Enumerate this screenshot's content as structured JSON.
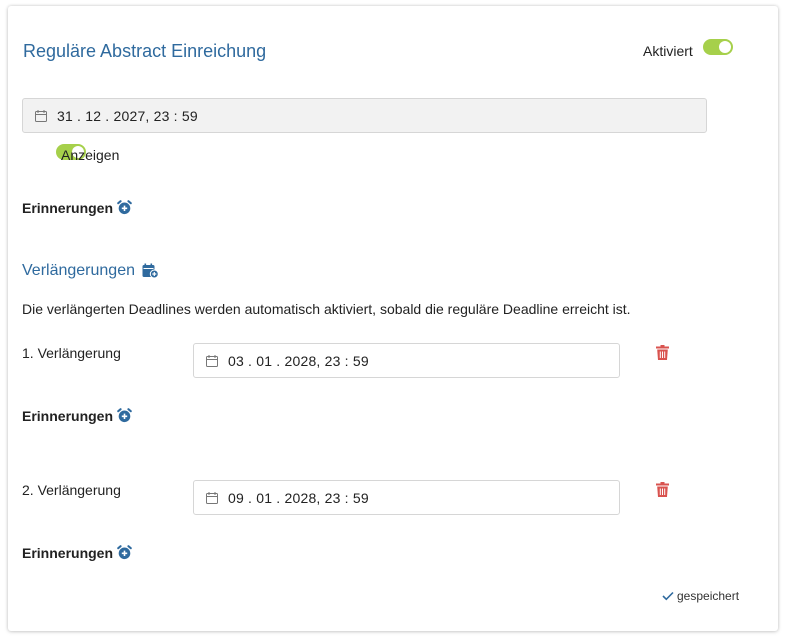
{
  "header": {
    "title": "Reguläre Abstract Einreichung",
    "activated_label": "Aktiviert"
  },
  "main_deadline": {
    "value": "31 . 12 . 2027, 23 : 59",
    "show_label": "Anzeigen"
  },
  "reminders_label": "Erinnerungen",
  "extensions": {
    "title": "Verlängerungen",
    "info": "Die verlängerten Deadlines werden automatisch aktiviert, sobald die reguläre Deadline erreicht ist.",
    "items": [
      {
        "label": "1. Verlängerung",
        "value": "03 . 01 . 2028, 23 : 59",
        "reminders_label": "Erinnerungen"
      },
      {
        "label": "2. Verlängerung",
        "value": "09 . 01 . 2028, 23 : 59",
        "reminders_label": "Erinnerungen"
      }
    ]
  },
  "status": {
    "saved_label": "gespeichert"
  },
  "colors": {
    "accent": "#2f6a9e",
    "toggle_on": "#a6d04b",
    "danger": "#d9534f"
  },
  "icons": [
    "calendar-icon",
    "alarm-plus-icon",
    "calendar-plus-icon",
    "trash-icon",
    "check-icon"
  ]
}
